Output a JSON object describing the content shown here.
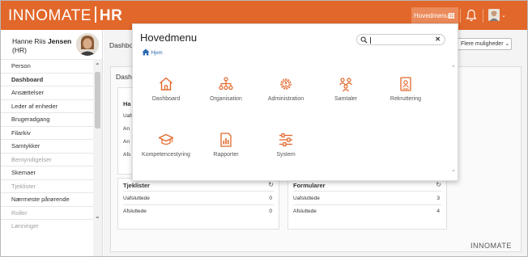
{
  "app": {
    "logo_main": "INNOMATE",
    "logo_suffix": "HR",
    "footer_logo": "INNOMATE"
  },
  "topbar": {
    "menu_label": "Hovedmenu",
    "icons": [
      "grid-icon",
      "bell-icon",
      "avatar",
      "chevron-down-icon"
    ]
  },
  "profile": {
    "first_name": "Hanne Riis",
    "last_name": "Jensen",
    "role": "(HR)"
  },
  "sidebar": {
    "items": [
      {
        "label": "Person",
        "state": "normal"
      },
      {
        "label": "Dashboard",
        "state": "active"
      },
      {
        "label": "Ansættelser",
        "state": "normal"
      },
      {
        "label": "Leder af enheder",
        "state": "normal"
      },
      {
        "label": "Brugeradgang",
        "state": "normal"
      },
      {
        "label": "Filarkiv",
        "state": "normal"
      },
      {
        "label": "Samtykker",
        "state": "normal"
      },
      {
        "label": "Bemyndigelser",
        "state": "disabled"
      },
      {
        "label": "Skemaer",
        "state": "normal"
      },
      {
        "label": "Tjeklister",
        "state": "disabled"
      },
      {
        "label": "Nærmeste pårørende",
        "state": "normal"
      },
      {
        "label": "Roller",
        "state": "disabled"
      },
      {
        "label": "Lønninger",
        "state": "disabled"
      }
    ]
  },
  "main": {
    "title": "Dashbo",
    "panel_title": "Dash",
    "more_options": "Flere muligheder",
    "card_partial_title": "Ha",
    "card_partial_rows": [
      "Uafs",
      "An",
      "An",
      "Afs"
    ],
    "cards": [
      {
        "title": "Tjeklister",
        "rows": [
          {
            "label": "Uafsluttede",
            "value": "0"
          },
          {
            "label": "Afsluttede",
            "value": "0"
          }
        ]
      },
      {
        "title": "Formularer",
        "rows": [
          {
            "label": "Uafsluttede",
            "value": "3"
          },
          {
            "label": "Afsluttede",
            "value": "4"
          }
        ]
      }
    ]
  },
  "overlay": {
    "title": "Hovedmenu",
    "breadcrumb": "Hjem",
    "search_value": "",
    "accent_color": "#e2672a",
    "tiles": [
      {
        "label": "Dashboard",
        "icon": "home-icon"
      },
      {
        "label": "Organisation",
        "icon": "org-chart-icon"
      },
      {
        "label": "Administration",
        "icon": "gear-person-icon"
      },
      {
        "label": "Samtaler",
        "icon": "people-talk-icon"
      },
      {
        "label": "Rekruttering",
        "icon": "recruit-icon"
      },
      {
        "label": "Kompetencestyring",
        "icon": "graduation-cap-icon"
      },
      {
        "label": "Rapporter",
        "icon": "report-icon"
      },
      {
        "label": "System",
        "icon": "sliders-icon"
      }
    ]
  }
}
